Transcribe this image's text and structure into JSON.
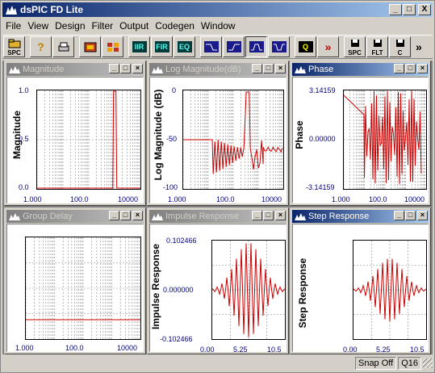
{
  "app": {
    "title": "dsPIC FD Lite",
    "minimize": "_",
    "maximize": "□",
    "close": "X"
  },
  "menu": [
    "File",
    "View",
    "Design",
    "Filter",
    "Output",
    "Codegen",
    "Window"
  ],
  "toolbar": {
    "spc_label": "SPC",
    "iir_label": "IIR",
    "fir_label": "FIR",
    "eq_label": "EQ",
    "q_label": "Q",
    "save_spc_label": "SPC",
    "save_flt_label": "FLT",
    "save_c_label": "C",
    "more_label": "»"
  },
  "windows": {
    "magnitude": {
      "title": "Magnitude",
      "ylabel": "Magnitude",
      "yticks": [
        "1.0",
        "0.5",
        "0.0"
      ],
      "xticks": [
        "1.000",
        "100.0",
        "10000"
      ]
    },
    "logmag": {
      "title": "Log Magnitude(dB)",
      "ylabel": "Log Magnitude (dB)",
      "yticks": [
        "0",
        "-50",
        "-100"
      ],
      "xticks": [
        "1.000",
        "100.0",
        "10000"
      ]
    },
    "phase": {
      "title": "Phase",
      "ylabel": "Phase",
      "yticks": [
        "3.14159",
        "0.00000",
        "-3.14159"
      ],
      "xticks": [
        "1.000",
        "100.0",
        "10000"
      ]
    },
    "group": {
      "title": "Group Delay",
      "xticks": [
        "1.000",
        "100.0",
        "10000"
      ]
    },
    "impulse": {
      "title": "Impulse Response",
      "ylabel": "Impulse Response",
      "yticks": [
        "0.102466",
        "0.000000",
        "-0.102466"
      ],
      "xticks": [
        "0.00",
        "5.25",
        "10.5"
      ]
    },
    "step": {
      "title": "Step Response",
      "ylabel": "Step Response",
      "xticks": [
        "0.00",
        "5.25",
        "10.5"
      ]
    }
  },
  "status": {
    "snap": "Snap Off",
    "q": "Q16"
  },
  "colors": {
    "trace": "#cc0000",
    "active_title": "#0a246a",
    "inactive_title": "#808080",
    "tick_text": "#000080"
  }
}
